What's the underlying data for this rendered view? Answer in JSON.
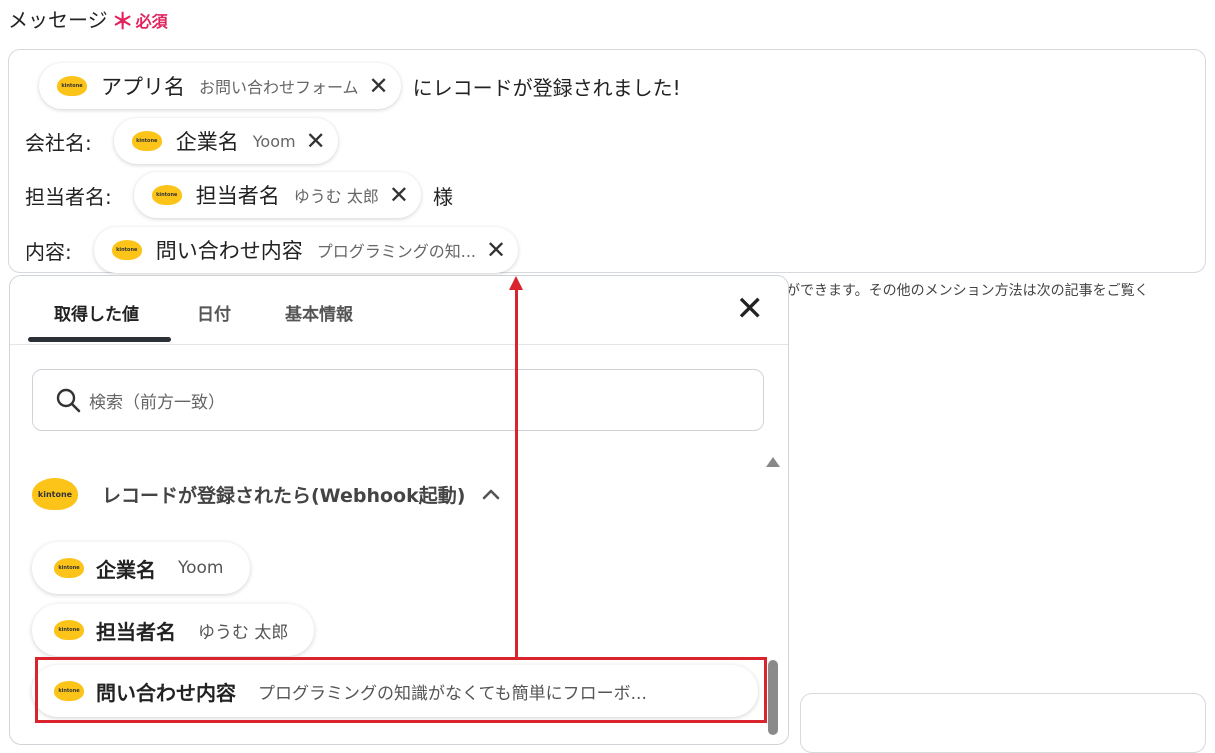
{
  "field": {
    "label": "メッセージ",
    "required_mark": "＊",
    "required_text": "必須"
  },
  "message": {
    "line1": {
      "chip_name": "アプリ名",
      "chip_value": "お問い合わせフォーム",
      "post": "にレコードが登録されました!"
    },
    "line2": {
      "pre": "会社名:",
      "chip_name": "企業名",
      "chip_value": "Yoom"
    },
    "line3": {
      "pre": "担当者名:",
      "chip_name": "担当者名",
      "chip_value": "ゆうむ 太郎",
      "post": "様"
    },
    "line4": {
      "pre": "内容:",
      "chip_name": "問い合わせ内容",
      "chip_value": "プログラミングの知..."
    }
  },
  "remove_glyph": "✕",
  "logo_text": "kintone",
  "help_text": "ができます。その他のメンション方法は次の記事をご覧く",
  "panel": {
    "tabs": [
      "取得した値",
      "日付",
      "基本情報"
    ],
    "active_tab": 0,
    "close_glyph": "✕",
    "search_placeholder": "検索（前方一致）",
    "section_title": "レコードが登録されたら(Webhook起動)",
    "items": [
      {
        "name": "企業名",
        "value": "Yoom"
      },
      {
        "name": "担当者名",
        "value": "ゆうむ 太郎"
      },
      {
        "name": "問い合わせ内容",
        "value": "プログラミングの知識がなくても簡単にフローボ..."
      }
    ]
  },
  "colors": {
    "required": "#e0245e",
    "annotation": "#d9232d",
    "kintone": "#fcc419"
  }
}
